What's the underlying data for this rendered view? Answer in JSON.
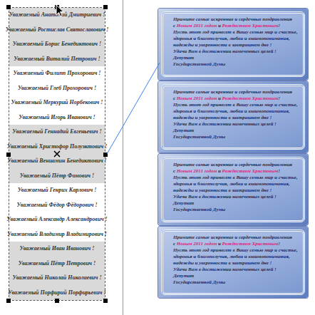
{
  "names": [
    {
      "text": "Уважаемый Анатолий Дмитриевич !",
      "shaded": true
    },
    {
      "text": "Уважаемый Ростислав Святославович !",
      "shaded": true
    },
    {
      "text": "Уважаемый Борис Бенедиктович !",
      "shaded": true
    },
    {
      "text": "Уважаемый Виталий Петрович !",
      "shaded": true
    },
    {
      "text": "Уважаемый Филипп Прохорович !",
      "shaded": false
    },
    {
      "text": "Уважаемый Глеб Прохорович !",
      "shaded": false
    },
    {
      "text": "Уважаемый Меркурий Норбекович !",
      "shaded": false
    },
    {
      "text": "Уважаемый Игорь Иванович !",
      "shaded": false
    },
    {
      "text": "Уважаемый Геннадий Евгеньевич !",
      "shaded": true
    },
    {
      "text": "Уважаемый Христофор Полуэктович !",
      "shaded": true
    },
    {
      "text": "Уважаемый Вениамин Бенедиктович !",
      "shaded": true
    },
    {
      "text": "Уважаемый Пётр Фомович !",
      "shaded": true
    },
    {
      "text": "Уважаемый Генрих Карлович !",
      "shaded": false
    },
    {
      "text": "Уважаемый Фёдор Фёдорович !",
      "shaded": false
    },
    {
      "text": "Уважаемый Александр Александрович !",
      "shaded": false
    },
    {
      "text": "Уважаемый Владимир Владимирович !",
      "shaded": false
    },
    {
      "text": "Уважаемый Иван Иванович !",
      "shaded": true
    },
    {
      "text": "Уважаемый Пётр Петрович !",
      "shaded": true
    },
    {
      "text": "Уважаемый Николай Николаевич !",
      "shaded": true
    },
    {
      "text": "Уважаемый Порфирий Порфирьевич !",
      "shaded": true
    }
  ],
  "cards": [
    {
      "lines": [
        [
          {
            "text": "Примите самые искренние и сердечные поздравления",
            "highlight": false
          }
        ],
        [
          {
            "text": "с ",
            "highlight": false
          },
          {
            "text": "Новым 2011 годом",
            "highlight": true
          },
          {
            "text": " и ",
            "highlight": false
          },
          {
            "text": "Рождеством Христовым",
            "highlight": true
          },
          {
            "text": "!",
            "highlight": false
          }
        ],
        [
          {
            "text": "Пусть этот год принесет в Вашу семью мир и счастье,",
            "highlight": false
          }
        ],
        [
          {
            "text": "здоровья и благополучия, любви и взаимопонимания,",
            "highlight": false
          }
        ],
        [
          {
            "text": "надежды и уверенности в завтрашнем дне !",
            "highlight": false
          }
        ],
        [
          {
            "text": "Удачи Вам в достижении намеченных целей !",
            "highlight": false
          }
        ],
        [
          {
            "text": "Депутат",
            "highlight": false
          }
        ],
        [
          {
            "text": "Государственной Думы",
            "highlight": false
          }
        ]
      ]
    },
    {
      "lines": [
        [
          {
            "text": "Примите самые искренние и сердечные поздравления",
            "highlight": false
          }
        ],
        [
          {
            "text": "с ",
            "highlight": false
          },
          {
            "text": "Новым 2011 годом",
            "highlight": true
          },
          {
            "text": " и ",
            "highlight": false
          },
          {
            "text": "Рождеством Христовым",
            "highlight": true
          },
          {
            "text": "!",
            "highlight": false
          }
        ],
        [
          {
            "text": "Пусть этот год принесет в Вашу семью мир и счастье,",
            "highlight": false
          }
        ],
        [
          {
            "text": "здоровья и благополучия, любви и взаимопонимания,",
            "highlight": false
          }
        ],
        [
          {
            "text": "надежды и уверенности в завтрашнем дне !",
            "highlight": false
          }
        ],
        [
          {
            "text": "Удачи Вам в достижении намеченных целей !",
            "highlight": false
          }
        ],
        [
          {
            "text": "Депутат",
            "highlight": false
          }
        ],
        [
          {
            "text": "Государственной Думы",
            "highlight": false
          }
        ]
      ]
    },
    {
      "lines": [
        [
          {
            "text": "Примите самые искренние и сердечные поздравления",
            "highlight": false
          }
        ],
        [
          {
            "text": "с ",
            "highlight": false
          },
          {
            "text": "Новым 2011 годом",
            "highlight": true
          },
          {
            "text": " и ",
            "highlight": false
          },
          {
            "text": "Рождеством Христовым",
            "highlight": true
          },
          {
            "text": "!",
            "highlight": false
          }
        ],
        [
          {
            "text": "Пусть этот год принесет в Вашу семью мир и счастье,",
            "highlight": false
          }
        ],
        [
          {
            "text": "здоровья и благополучия, любви и взаимопонимания,",
            "highlight": false
          }
        ],
        [
          {
            "text": "надежды и уверенности в завтрашнем дне !",
            "highlight": false
          }
        ],
        [
          {
            "text": "Удачи Вам в достижении намеченных целей !",
            "highlight": false
          }
        ],
        [
          {
            "text": "Депутат",
            "highlight": false
          }
        ],
        [
          {
            "text": "Государственной Думы",
            "highlight": false
          }
        ]
      ]
    },
    {
      "lines": [
        [
          {
            "text": "Примите самые искренние и сердечные поздравления",
            "highlight": false
          }
        ],
        [
          {
            "text": "с ",
            "highlight": false
          },
          {
            "text": "Новым 2011 годом",
            "highlight": true
          },
          {
            "text": " и ",
            "highlight": false
          },
          {
            "text": "Рождеством Христовым",
            "highlight": true
          },
          {
            "text": "!",
            "highlight": false
          }
        ],
        [
          {
            "text": "Пусть этот год принесет в Вашу семью мир и счастье,",
            "highlight": false
          }
        ],
        [
          {
            "text": "здоровья и благополучия, любви и взаимопонимания,",
            "highlight": false
          }
        ],
        [
          {
            "text": "надежды и уверенности в завтрашнем дне !",
            "highlight": false
          }
        ],
        [
          {
            "text": "Удачи Вам в достижении намеченных целей !",
            "highlight": false
          }
        ],
        [
          {
            "text": "Депутат",
            "highlight": false
          }
        ],
        [
          {
            "text": "Государственной Думы",
            "highlight": false
          }
        ]
      ]
    }
  ]
}
